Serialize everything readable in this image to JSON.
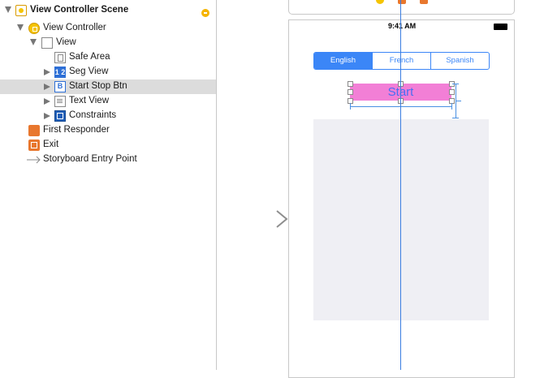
{
  "outline": {
    "rows": [
      {
        "label": "View Controller Scene",
        "icon": "scene-icon",
        "bold": true
      },
      {
        "label": "View Controller",
        "icon": "view-controller-icon"
      },
      {
        "label": "View",
        "icon": "view-icon"
      },
      {
        "label": "Safe Area",
        "icon": "safe-area-icon"
      },
      {
        "label": "Seg View",
        "icon": "segmented-control-icon",
        "icon_text": "1 2"
      },
      {
        "label": "Start Stop Btn",
        "icon": "button-icon",
        "icon_text": "B",
        "selected": true
      },
      {
        "label": "Text View",
        "icon": "text-view-icon"
      },
      {
        "label": "Constraints",
        "icon": "constraints-icon"
      },
      {
        "label": "First Responder",
        "icon": "first-responder-icon"
      },
      {
        "label": "Exit",
        "icon": "exit-icon"
      },
      {
        "label": "Storyboard Entry Point",
        "icon": "entry-point-arrow-icon"
      }
    ]
  },
  "device": {
    "status_time": "9:41 AM",
    "segments": [
      "English",
      "French",
      "Spanish"
    ],
    "selected_segment": "English",
    "button_label": "Start"
  },
  "colors": {
    "accent": "#3b86f7",
    "button_bg": "#f27fd6",
    "button_text": "#4a6ef2",
    "selection_row": "#dcdcdc",
    "text_view_bg": "#efeff4"
  }
}
